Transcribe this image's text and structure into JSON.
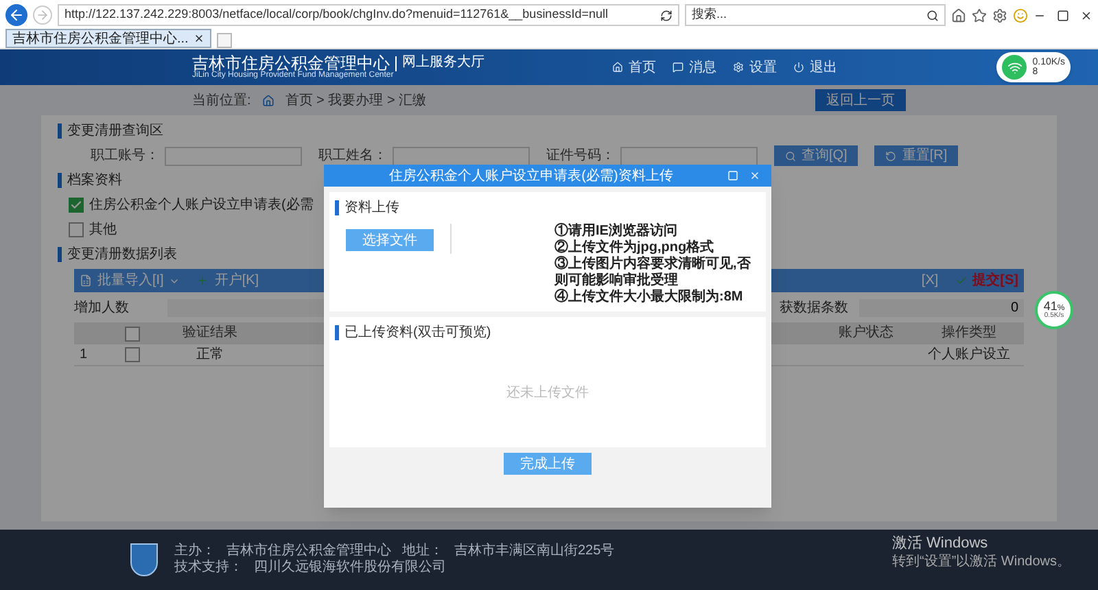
{
  "browser": {
    "url": "http://122.137.242.229:8003/netface/local/corp/book/chgInv.do?menuid=112761&__businessId=null",
    "search_placeholder": "搜索...",
    "tabs": [
      {
        "title": "吉林市住房公积金管理中心...",
        "selected": true
      }
    ]
  },
  "header": {
    "title": "吉林市住房公积金管理中心",
    "portal": "网上服务大厅",
    "subtitle": "JiLin City Housing Provident Fund Management Center",
    "nav": [
      {
        "label": "首页",
        "kind": "home"
      },
      {
        "label": "消息",
        "kind": "message"
      },
      {
        "label": "设置",
        "kind": "settings"
      },
      {
        "label": "退出",
        "kind": "logout"
      }
    ]
  },
  "net_widget": {
    "speed": "0.10K/s",
    "count": "8"
  },
  "breadcrumb": {
    "label": "当前位置:",
    "path": "首页 > 我要办理 > 汇缴",
    "back_button": "返回上一页"
  },
  "query": {
    "title": "变更清册查询区",
    "fields": [
      {
        "label": "职工账号："
      },
      {
        "label": "职工姓名："
      },
      {
        "label": "证件号码："
      }
    ],
    "buttons": [
      {
        "label": "查询[Q]",
        "kind": "search"
      },
      {
        "label": "重置[R]",
        "kind": "reset"
      }
    ]
  },
  "materials": {
    "title": "档案资料",
    "items": [
      {
        "label": "住房公积金个人账户设立申请表(必需",
        "checked": true
      },
      {
        "label": "其他",
        "checked": false
      }
    ]
  },
  "list": {
    "title": "变更清册数据列表",
    "toolbar": [
      {
        "label": "批量导入[I]",
        "kind": "import"
      },
      {
        "label": "开户[K]",
        "kind": "add"
      },
      {
        "label": "[X]",
        "kind": "plain"
      },
      {
        "label": "提交[S]",
        "kind": "submit"
      }
    ],
    "summary": {
      "label": "增加人数",
      "count_label": "获数据条数",
      "count": "0"
    },
    "columns": [
      "验证结果",
      "账户状态",
      "操作类型"
    ],
    "select_all_checked": false,
    "rows": [
      {
        "index": "1",
        "checked": false,
        "result": "正常",
        "status": "",
        "operation": "个人账户设立"
      }
    ]
  },
  "dialog": {
    "title": "住房公积金个人账户设立申请表(必需)资料上传",
    "upload_title": "资料上传",
    "choose_button": "选择文件",
    "notes": [
      "①请用IE浏览器访问",
      "②上传文件为jpg,png格式",
      "③上传图片内容要求清晰可见,否则可能影响审批受理",
      "④上传文件大小最大限制为:8M"
    ],
    "uploaded_title": "已上传资料(双击可预览)",
    "empty_text": "还未上传文件",
    "done_button": "完成上传"
  },
  "float_widget": {
    "percent": "41",
    "unit": "%",
    "speed": "0.5K/s"
  },
  "footer": {
    "host_label": "主办：",
    "host": "吉林市住房公积金管理中心",
    "address_label": "地址：",
    "address": "吉林市丰满区南山街225号",
    "support_label": "技术支持：",
    "support": "四川久远银海软件股份有限公司"
  },
  "os_notice": {
    "title": "激活 Windows",
    "text": "转到“设置”以激活 Windows。"
  }
}
